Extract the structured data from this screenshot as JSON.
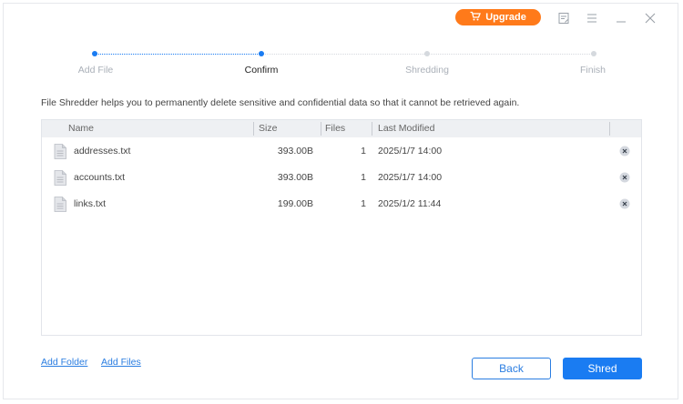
{
  "titlebar": {
    "upgrade_label": "Upgrade",
    "upgrade_color": "#ff7a1a"
  },
  "steps": [
    {
      "label": "Add File",
      "state": "done"
    },
    {
      "label": "Confirm",
      "state": "active"
    },
    {
      "label": "Shredding",
      "state": "pending"
    },
    {
      "label": "Finish",
      "state": "pending"
    }
  ],
  "description": "File Shredder helps you to permanently delete sensitive and confidential data so that it cannot be retrieved again.",
  "table": {
    "columns": {
      "name": "Name",
      "size": "Size",
      "files": "Files",
      "modified": "Last Modified"
    },
    "rows": [
      {
        "name": "addresses.txt",
        "size": "393.00B",
        "files": "1",
        "modified": "2025/1/7 14:00"
      },
      {
        "name": "accounts.txt",
        "size": "393.00B",
        "files": "1",
        "modified": "2025/1/7 14:00"
      },
      {
        "name": "links.txt",
        "size": "199.00B",
        "files": "1",
        "modified": "2025/1/2 11:44"
      }
    ]
  },
  "footer": {
    "add_folder": "Add Folder",
    "add_files": "Add Files",
    "back": "Back",
    "shred": "Shred"
  },
  "colors": {
    "accent": "#1a7cf2",
    "upgrade": "#ff7a1a"
  }
}
